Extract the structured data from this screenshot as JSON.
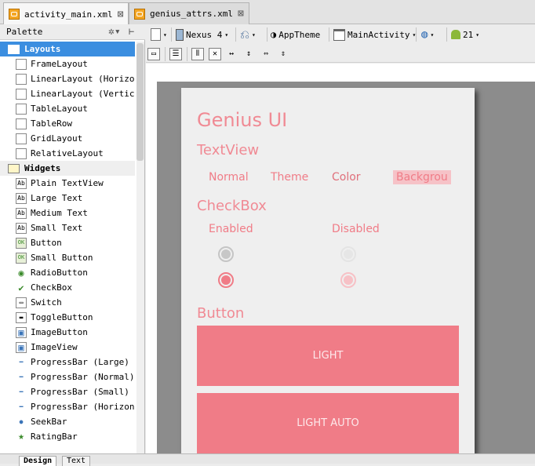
{
  "tabs": [
    {
      "label": "activity_main.xml",
      "active": true
    },
    {
      "label": "genius_attrs.xml",
      "active": false
    }
  ],
  "palette": {
    "title": "Palette",
    "sections": [
      {
        "label": "Layouts",
        "selected": true,
        "items": [
          {
            "label": "FrameLayout",
            "icon": "frame-layout-icon"
          },
          {
            "label": "LinearLayout (Horizont",
            "icon": "linear-layout-horizontal-icon"
          },
          {
            "label": "LinearLayout (Vertical",
            "icon": "linear-layout-vertical-icon"
          },
          {
            "label": "TableLayout",
            "icon": "table-layout-icon"
          },
          {
            "label": "TableRow",
            "icon": "table-row-icon"
          },
          {
            "label": "GridLayout",
            "icon": "grid-layout-icon"
          },
          {
            "label": "RelativeLayout",
            "icon": "relative-layout-icon"
          }
        ]
      },
      {
        "label": "Widgets",
        "selected": false,
        "items": [
          {
            "label": "Plain TextView",
            "icon": "text-view-icon",
            "glyph": "Ab"
          },
          {
            "label": "Large Text",
            "icon": "text-view-icon",
            "glyph": "Ab"
          },
          {
            "label": "Medium Text",
            "icon": "text-view-icon",
            "glyph": "Ab"
          },
          {
            "label": "Small Text",
            "icon": "text-view-icon",
            "glyph": "Ab"
          },
          {
            "label": "Button",
            "icon": "button-icon",
            "glyph": "OK"
          },
          {
            "label": "Small Button",
            "icon": "button-icon",
            "glyph": "OK"
          },
          {
            "label": "RadioButton",
            "icon": "radio-button-icon",
            "glyph": "◉"
          },
          {
            "label": "CheckBox",
            "icon": "checkbox-icon",
            "glyph": "✔"
          },
          {
            "label": "Switch",
            "icon": "switch-icon",
            "glyph": "▭"
          },
          {
            "label": "ToggleButton",
            "icon": "toggle-button-icon",
            "glyph": "▬"
          },
          {
            "label": "ImageButton",
            "icon": "image-button-icon",
            "glyph": "▣"
          },
          {
            "label": "ImageView",
            "icon": "image-view-icon",
            "glyph": "▣"
          },
          {
            "label": "ProgressBar (Large)",
            "icon": "progress-bar-icon",
            "glyph": "━"
          },
          {
            "label": "ProgressBar (Normal)",
            "icon": "progress-bar-icon",
            "glyph": "━"
          },
          {
            "label": "ProgressBar (Small)",
            "icon": "progress-bar-icon",
            "glyph": "━"
          },
          {
            "label": "ProgressBar (Horizonta",
            "icon": "progress-bar-icon",
            "glyph": "━"
          },
          {
            "label": "SeekBar",
            "icon": "seek-bar-icon",
            "glyph": "●"
          },
          {
            "label": "RatingBar",
            "icon": "rating-bar-icon",
            "glyph": "★"
          }
        ]
      }
    ]
  },
  "bottom_tabs": [
    "Design",
    "Text"
  ],
  "toolbar": {
    "device": "Nexus 4",
    "theme": "AppTheme",
    "activity": "MainActivity",
    "api": "21"
  },
  "preview": {
    "title": "Genius UI",
    "textview_heading": "TextView",
    "textview_items": [
      "Normal",
      "Theme",
      "Color",
      "Backgrou"
    ],
    "checkbox_heading": "CheckBox",
    "checkbox_enabled": "Enabled",
    "checkbox_disabled": "Disabled",
    "button_heading": "Button",
    "buttons": [
      "LIGHT",
      "LIGHT AUTO"
    ]
  },
  "colors": {
    "accent": "#f07c87",
    "selection": "#3b8ee0"
  }
}
